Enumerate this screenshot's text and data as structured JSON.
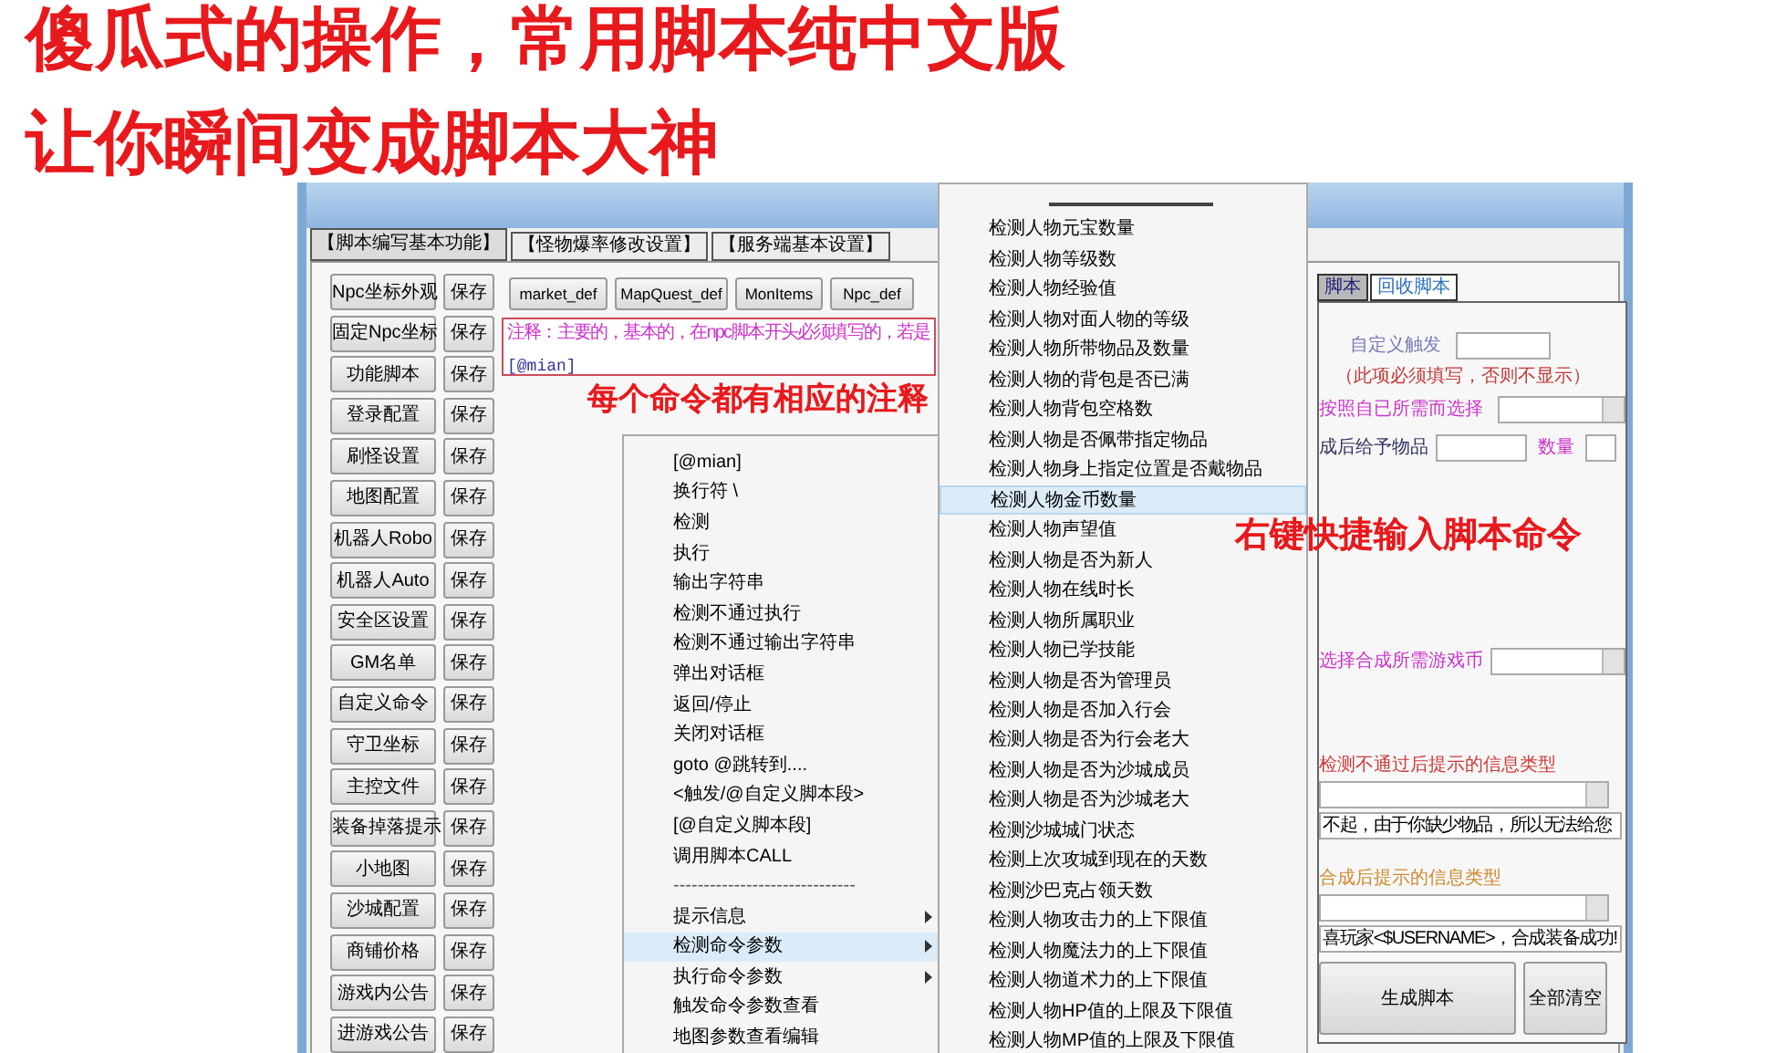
{
  "headline": [
    "傻瓜式的操作，常用脚本纯中文版",
    "让你瞬间变成脚本大神"
  ],
  "window": {
    "tabs": [
      {
        "label": "【脚本编写基本功能】",
        "selected": true
      },
      {
        "label": "【怪物爆率修改设置】",
        "selected": false
      },
      {
        "label": "【服务端基本设置】",
        "selected": false
      }
    ],
    "left_buttons": [
      {
        "label": "Npc坐标外观",
        "save": "保存"
      },
      {
        "label": "固定Npc坐标",
        "save": "保存"
      },
      {
        "label": "功能脚本",
        "save": "保存"
      },
      {
        "label": "登录配置",
        "save": "保存"
      },
      {
        "label": "刷怪设置",
        "save": "保存"
      },
      {
        "label": "地图配置",
        "save": "保存"
      },
      {
        "label": "机器人Robo",
        "save": "保存"
      },
      {
        "label": "机器人Auto",
        "save": "保存"
      },
      {
        "label": "安全区设置",
        "save": "保存"
      },
      {
        "label": "GM名单",
        "save": "保存"
      },
      {
        "label": "自定义命令",
        "save": "保存"
      },
      {
        "label": "守卫坐标",
        "save": "保存"
      },
      {
        "label": "主控文件",
        "save": "保存"
      },
      {
        "label": "装备掉落提示",
        "save": "保存"
      },
      {
        "label": "小地图",
        "save": "保存"
      },
      {
        "label": "沙城配置",
        "save": "保存"
      },
      {
        "label": "商铺价格",
        "save": "保存"
      },
      {
        "label": "游戏内公告",
        "save": "保存"
      },
      {
        "label": "进游戏公告",
        "save": "保存"
      }
    ],
    "top_buttons": [
      "market_def",
      "MapQuest_def",
      "MonItems",
      "Npc_def"
    ],
    "editor": {
      "note": "注释：主要的，基本的，在npc脚本开头必须填写的，若是",
      "code": "[@mian]"
    },
    "right_panel": {
      "tabs": [
        {
          "label": "脚本",
          "selected": true
        },
        {
          "label": "回收脚本",
          "selected": false
        }
      ],
      "trigger_label": "自定义触发",
      "required_note": "（此项必须填写，否则不显示）",
      "choose_label": "按照自已所需而选择",
      "item_label": "成后给予物品",
      "qty_label": "数量",
      "currency_label": "选择合成所需游戏币",
      "fail_label": "检测不通过后提示的信息类型",
      "fail_message": "不起，由于你缺少物品，所以无法给您",
      "success_label": "合成后提示的信息类型",
      "success_message": "喜玩家<$USERNAME>，合成装备成功!",
      "buttons": [
        "生成脚本",
        "全部清空"
      ]
    }
  },
  "context_menu": {
    "items": [
      {
        "label": "[@mian]",
        "kind": "item",
        "selected": false
      },
      {
        "label": "换行符 \\",
        "kind": "item",
        "selected": false
      },
      {
        "label": "检测",
        "kind": "item",
        "selected": false
      },
      {
        "label": "执行",
        "kind": "item",
        "selected": false
      },
      {
        "label": "输出字符串",
        "kind": "item",
        "selected": false
      },
      {
        "label": "检测不通过执行",
        "kind": "item",
        "selected": false
      },
      {
        "label": "检测不通过输出字符串",
        "kind": "item",
        "selected": false
      },
      {
        "label": "弹出对话框",
        "kind": "item",
        "selected": false
      },
      {
        "label": "返回/停止",
        "kind": "item",
        "selected": false
      },
      {
        "label": "关闭对话框",
        "kind": "item",
        "selected": false
      },
      {
        "label": "goto @跳转到....",
        "kind": "item",
        "selected": false
      },
      {
        "label": "<触发/@自定义脚本段>",
        "kind": "item",
        "selected": false
      },
      {
        "label": "[@自定义脚本段]",
        "kind": "item",
        "selected": false
      },
      {
        "label": "调用脚本CALL",
        "kind": "item",
        "selected": false
      },
      {
        "label": "------------------------------",
        "kind": "separator",
        "selected": false
      },
      {
        "label": "提示信息",
        "kind": "submenu",
        "selected": false
      },
      {
        "label": "检测命令参数",
        "kind": "submenu",
        "selected": true
      },
      {
        "label": "执行命令参数",
        "kind": "submenu",
        "selected": false
      },
      {
        "label": "触发命令参数查看",
        "kind": "item",
        "selected": false
      },
      {
        "label": "地图参数查看编辑",
        "kind": "item",
        "selected": false
      }
    ]
  },
  "submenu": {
    "items": [
      {
        "label": "检测人物元宝数量",
        "selected": false
      },
      {
        "label": "检测人物等级数",
        "selected": false
      },
      {
        "label": "检测人物经验值",
        "selected": false
      },
      {
        "label": "检测人物对面人物的等级",
        "selected": false
      },
      {
        "label": "检测人物所带物品及数量",
        "selected": false
      },
      {
        "label": "检测人物的背包是否已满",
        "selected": false
      },
      {
        "label": "检测人物背包空格数",
        "selected": false
      },
      {
        "label": "检测人物是否佩带指定物品",
        "selected": false
      },
      {
        "label": "检测人物身上指定位置是否戴物品",
        "selected": false
      },
      {
        "label": "检测人物金币数量",
        "selected": true
      },
      {
        "label": "检测人物声望值",
        "selected": false
      },
      {
        "label": "检测人物是否为新人",
        "selected": false
      },
      {
        "label": "检测人物在线时长",
        "selected": false
      },
      {
        "label": "检测人物所属职业",
        "selected": false
      },
      {
        "label": "检测人物已学技能",
        "selected": false
      },
      {
        "label": "检测人物是否为管理员",
        "selected": false
      },
      {
        "label": "检测人物是否加入行会",
        "selected": false
      },
      {
        "label": "检测人物是否为行会老大",
        "selected": false
      },
      {
        "label": "检测人物是否为沙城成员",
        "selected": false
      },
      {
        "label": "检测人物是否为沙城老大",
        "selected": false
      },
      {
        "label": "检测沙城城门状态",
        "selected": false
      },
      {
        "label": "检测上次攻城到现在的天数",
        "selected": false
      },
      {
        "label": "检测沙巴克占领天数",
        "selected": false
      },
      {
        "label": "检测人物攻击力的上下限值",
        "selected": false
      },
      {
        "label": "检测人物魔法力的上下限值",
        "selected": false
      },
      {
        "label": "检测人物道术力的上下限值",
        "selected": false
      },
      {
        "label": "检测人物HP值的上限及下限值",
        "selected": false
      },
      {
        "label": "检测人物MP值的上限及下限值",
        "selected": false
      }
    ]
  },
  "annotations": [
    "每个命令都有相应的注释",
    "右键快捷输入脚本命令"
  ]
}
